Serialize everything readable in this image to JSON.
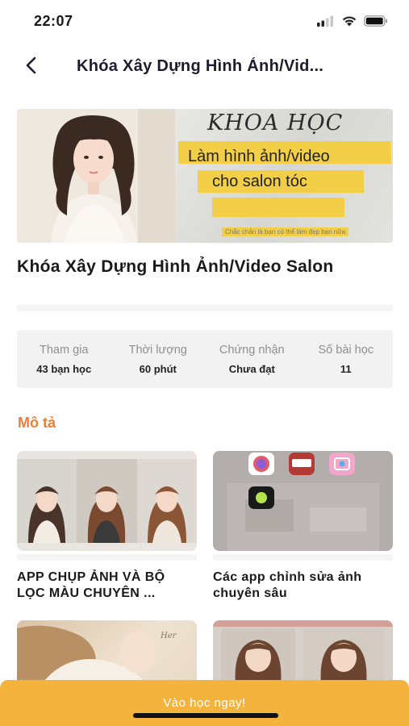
{
  "status_bar": {
    "time": "22:07"
  },
  "nav": {
    "title": "Khóa Xây Dựng Hình Ảnh/Vid..."
  },
  "banner": {
    "heading": "KHOA HỌC",
    "line1": "Làm hình ảnh/video",
    "line2": "cho salon tóc",
    "tagline": "Chắc chắn là bạn có thể làm đẹp bạn nữa"
  },
  "course": {
    "title": "Khóa Xây Dựng Hình Ảnh/Video Salon"
  },
  "stats": [
    {
      "label": "Tham gia",
      "value": "43 bạn học"
    },
    {
      "label": "Thời lượng",
      "value": "60 phút"
    },
    {
      "label": "Chứng nhận",
      "value": "Chưa đạt"
    },
    {
      "label": "Số bài học",
      "value": "11"
    }
  ],
  "description": {
    "title": "Mô tả"
  },
  "lessons": [
    {
      "title": "APP CHỤP ẢNH VÀ BỘ LỌC MÀU CHUYÊN ..."
    },
    {
      "title": "Các app chỉnh sửa ảnh chuyên sâu",
      "apps": [
        "FaceApp",
        "Remini",
        "BeautyPlus"
      ]
    },
    {
      "title": "",
      "caption": "Her"
    },
    {
      "title": ""
    }
  ],
  "cta": {
    "label": "Vào học ngay!"
  },
  "colors": {
    "accent": "#e8803a",
    "cta": "#f4b33d",
    "highlight": "#f3cf48"
  }
}
